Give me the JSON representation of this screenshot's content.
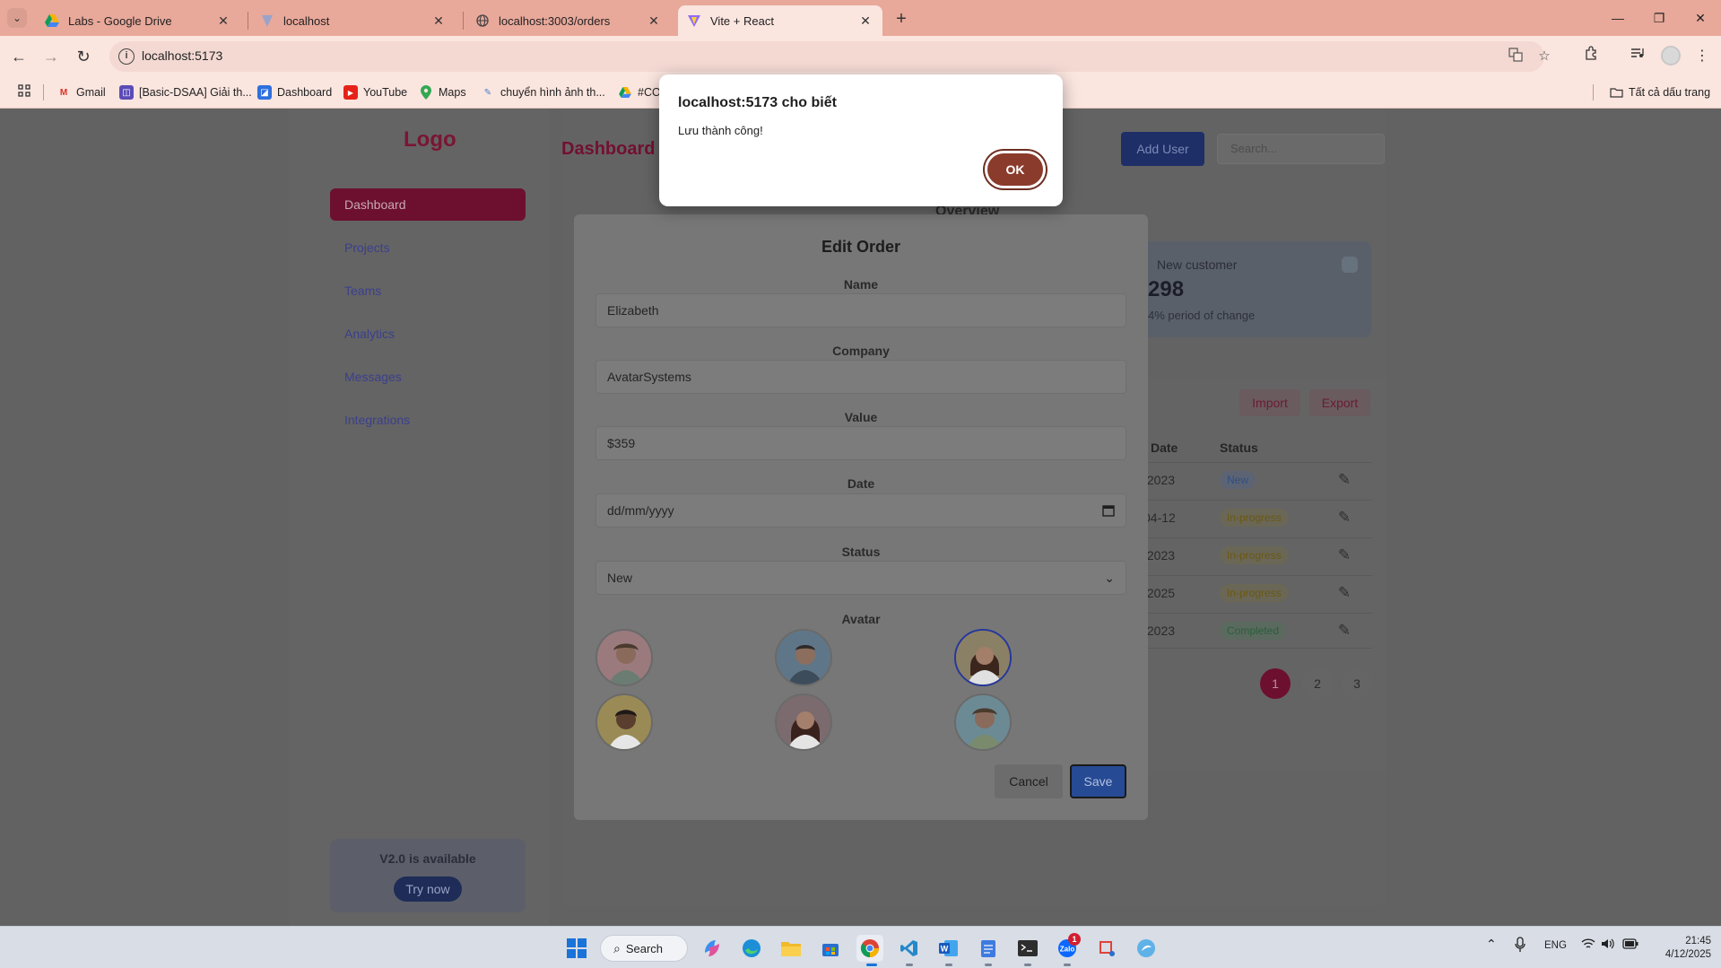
{
  "browser": {
    "tabs": [
      {
        "title": "Labs - Google Drive"
      },
      {
        "title": "localhost"
      },
      {
        "title": "localhost:3003/orders"
      },
      {
        "title": "Vite + React"
      }
    ],
    "address": "localhost:5173",
    "bookmarks": [
      "Gmail",
      "[Basic-DSAA] Giải th...",
      "Dashboard",
      "YouTube",
      "Maps",
      "chuyển hình ảnh th...",
      "#CO"
    ],
    "all_bookmarks": "Tất cả dấu trang"
  },
  "app": {
    "logo": "Logo",
    "nav": [
      "Dashboard",
      "Projects",
      "Teams",
      "Analytics",
      "Messages",
      "Integrations"
    ],
    "page_title": "Dashboard",
    "add_user": "Add User",
    "search_placeholder": "Search...",
    "overview_title": "Overview",
    "stat": {
      "label": "New customer",
      "value": "298",
      "change": "4% period of change"
    },
    "import": "Import",
    "export": "Export",
    "table_headers": [
      "Date",
      "Status"
    ],
    "rows": [
      {
        "date": "/2023",
        "status": "New"
      },
      {
        "date": "04-12",
        "status": "In-progress"
      },
      {
        "date": "/2023",
        "status": "In-progress"
      },
      {
        "date": "/2025",
        "status": "In-progress"
      },
      {
        "date": "/2023",
        "status": "Completed"
      }
    ],
    "pages": [
      "1",
      "2",
      "3"
    ],
    "promo_title": "V2.0 is available",
    "promo_button": "Try now"
  },
  "modal": {
    "title": "Edit Order",
    "labels": {
      "name": "Name",
      "company": "Company",
      "value": "Value",
      "date": "Date",
      "status": "Status",
      "avatar": "Avatar"
    },
    "values": {
      "name": "Elizabeth",
      "company": "AvatarSystems",
      "value": "$359",
      "date": "dd/mm/yyyy",
      "status": "New"
    },
    "cancel": "Cancel",
    "save": "Save"
  },
  "alert": {
    "title": "localhost:5173 cho biết",
    "message": "Lưu thành công!",
    "ok": "OK"
  },
  "taskbar": {
    "search": "Search",
    "lang": "ENG",
    "time": "21:45",
    "date": "4/12/2025",
    "notif_count": "1"
  }
}
